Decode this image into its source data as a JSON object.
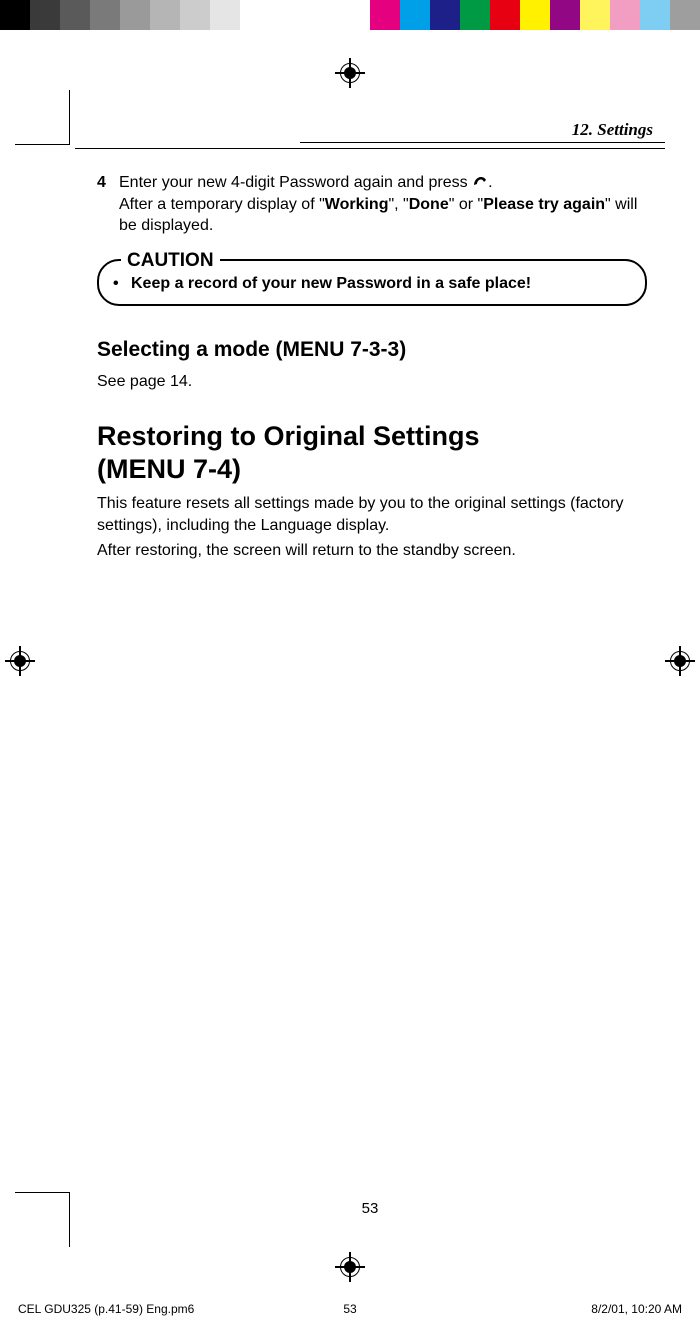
{
  "colorbar": {
    "left": [
      "#000000",
      "#3a3a3a",
      "#5a5a5a",
      "#7a7a7a",
      "#9a9a9a",
      "#b5b5b5",
      "#cccccc",
      "#e5e5e5",
      "#ffffff"
    ],
    "right": [
      "#e4007f",
      "#00a0e9",
      "#1d2088",
      "#009944",
      "#e60012",
      "#fff100",
      "#920783",
      "#fff45c",
      "#f19ec2",
      "#7ecef4",
      "#9e9e9f"
    ]
  },
  "header": {
    "chapter": "12. Settings"
  },
  "step4": {
    "num": "4",
    "line1_a": "Enter your new 4-digit Password again and press ",
    "line1_b": ".",
    "line2_a": "After a temporary display of \"",
    "working": "Working",
    "line2_b": "\", \"",
    "done": "Done",
    "line2_c": "\" or \"",
    "try_again": "Please try again",
    "line2_d": "\" will be displayed."
  },
  "caution": {
    "label": "CAUTION",
    "bullet": "•",
    "text": "Keep a record of your new Password in a safe place!"
  },
  "mode_section": {
    "heading": "Selecting a mode (MENU 7-3-3)",
    "body": "See page 14."
  },
  "restore_section": {
    "heading_l1": "Restoring to Original Settings",
    "heading_l2": "(MENU 7-4)",
    "body1": "This feature resets all settings made by you to the original settings (factory settings), including the Language display.",
    "body2": "After restoring, the screen will return to the standby screen."
  },
  "page_number": "53",
  "footer": {
    "file": "CEL GDU325 (p.41-59) Eng.pm6",
    "page": "53",
    "date": "8/2/01, 10:20 AM"
  }
}
